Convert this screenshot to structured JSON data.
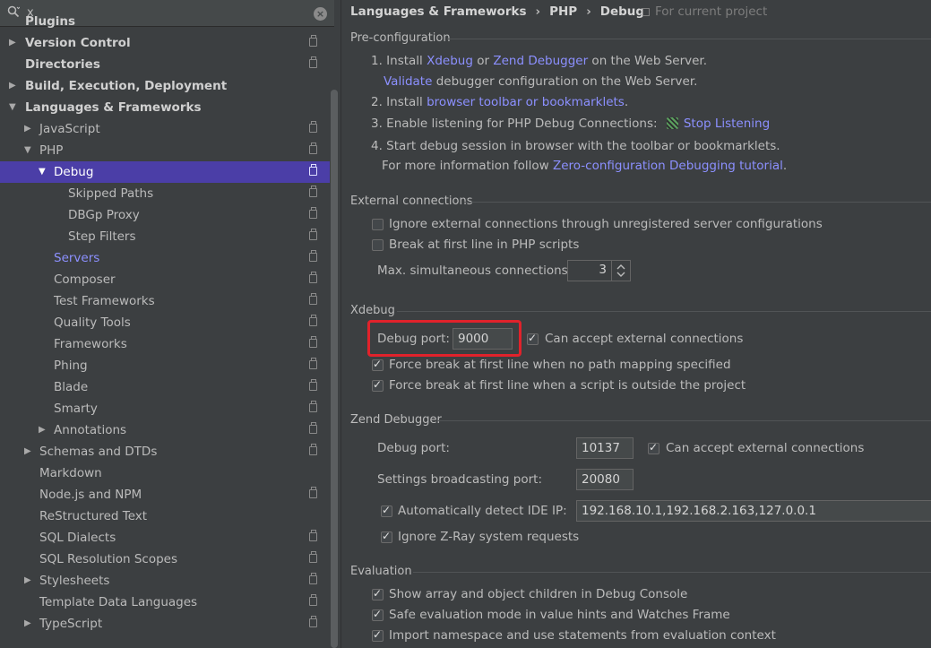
{
  "search": {
    "value": "x"
  },
  "tree": [
    {
      "label": "Plugins",
      "depth": 0,
      "bold": true
    },
    {
      "label": "Version Control",
      "depth": 0,
      "bold": true,
      "arrow": "right",
      "proj": true
    },
    {
      "label": "Directories",
      "depth": 0,
      "bold": true,
      "proj": true
    },
    {
      "label": "Build, Execution, Deployment",
      "depth": 0,
      "bold": true,
      "arrow": "right"
    },
    {
      "label": "Languages & Frameworks",
      "depth": 0,
      "bold": true,
      "arrow": "down"
    },
    {
      "label": "JavaScript",
      "depth": 1,
      "arrow": "right",
      "proj": true
    },
    {
      "label": "PHP",
      "depth": 1,
      "arrow": "down",
      "proj": true
    },
    {
      "label": "Debug",
      "depth": 2,
      "arrow": "down",
      "proj": true,
      "selected": true
    },
    {
      "label": "Skipped Paths",
      "depth": 3,
      "proj": true
    },
    {
      "label": "DBGp Proxy",
      "depth": 3,
      "proj": true
    },
    {
      "label": "Step Filters",
      "depth": 3,
      "proj": true
    },
    {
      "label": "Servers",
      "depth": 2,
      "proj": true,
      "link": true
    },
    {
      "label": "Composer",
      "depth": 2,
      "proj": true
    },
    {
      "label": "Test Frameworks",
      "depth": 2,
      "proj": true
    },
    {
      "label": "Quality Tools",
      "depth": 2,
      "proj": true
    },
    {
      "label": "Frameworks",
      "depth": 2,
      "proj": true
    },
    {
      "label": "Phing",
      "depth": 2,
      "proj": true
    },
    {
      "label": "Blade",
      "depth": 2,
      "proj": true
    },
    {
      "label": "Smarty",
      "depth": 2,
      "proj": true
    },
    {
      "label": "Annotations",
      "depth": 2,
      "arrow": "right",
      "proj": true
    },
    {
      "label": "Schemas and DTDs",
      "depth": 1,
      "arrow": "right",
      "proj": true
    },
    {
      "label": "Markdown",
      "depth": 1
    },
    {
      "label": "Node.js and NPM",
      "depth": 1,
      "proj": true
    },
    {
      "label": "ReStructured Text",
      "depth": 1
    },
    {
      "label": "SQL Dialects",
      "depth": 1,
      "proj": true
    },
    {
      "label": "SQL Resolution Scopes",
      "depth": 1,
      "proj": true
    },
    {
      "label": "Stylesheets",
      "depth": 1,
      "arrow": "right",
      "proj": true
    },
    {
      "label": "Template Data Languages",
      "depth": 1,
      "proj": true
    },
    {
      "label": "TypeScript",
      "depth": 1,
      "arrow": "right",
      "proj": true
    }
  ],
  "breadcrumb": {
    "c1": "Languages & Frameworks",
    "sep": "›",
    "c2": "PHP",
    "c3": "Debug",
    "for_project": "For current project"
  },
  "preconfig": {
    "title": "Pre-configuration",
    "s1_prefix": "1. Install ",
    "s1_link1": "Xdebug",
    "s1_or": " or ",
    "s1_link2": "Zend Debugger",
    "s1_suffix": " on the Web Server.",
    "s1b_link": "Validate",
    "s1b_suffix": " debugger configuration on the Web Server.",
    "s2_prefix": "2. Install ",
    "s2_link": "browser toolbar or bookmarklets",
    "s2_suffix": ".",
    "s3_prefix": "3. Enable listening for PHP Debug Connections:",
    "s3_link": "Stop Listening",
    "s4": "4. Start debug session in browser with the toolbar or bookmarklets.",
    "s4b_prefix": "For more information follow ",
    "s4b_link": "Zero-configuration Debugging tutorial",
    "s4b_suffix": "."
  },
  "external": {
    "title": "External connections",
    "ignore_label": "Ignore external connections through unregistered server configurations",
    "ignore_checked": false,
    "break_label": "Break at first line in PHP scripts",
    "break_checked": false,
    "max_label": "Max. simultaneous connections:",
    "max_value": "3"
  },
  "xdebug": {
    "title": "Xdebug",
    "port_label": "Debug port:",
    "port_value": "9000",
    "accept_label": "Can accept external connections",
    "accept_checked": true,
    "force1_label": "Force break at first line when no path mapping specified",
    "force1_checked": true,
    "force2_label": "Force break at first line when a script is outside the project",
    "force2_checked": true
  },
  "zend": {
    "title": "Zend Debugger",
    "port_label": "Debug port:",
    "port_value": "10137",
    "accept_label": "Can accept external connections",
    "accept_checked": true,
    "broadcast_label": "Settings broadcasting port:",
    "broadcast_value": "20080",
    "detect_label": "Automatically detect IDE IP:",
    "detect_checked": true,
    "ip_value": "192.168.10.1,192.168.2.163,127.0.0.1",
    "ignore_zray_label": "Ignore Z-Ray system requests",
    "ignore_zray_checked": true
  },
  "evaluation": {
    "title": "Evaluation",
    "e1_label": "Show array and object children in Debug Console",
    "e1_checked": true,
    "e2_label": "Safe evaluation mode in value hints and Watches Frame",
    "e2_checked": true,
    "e3_label": "Import namespace and use statements from evaluation context",
    "e3_checked": true
  },
  "colors": {
    "selected": "#4b3ea7",
    "link": "#8c90ff",
    "highlight": "#e1222b",
    "background": "#3c3f41"
  }
}
